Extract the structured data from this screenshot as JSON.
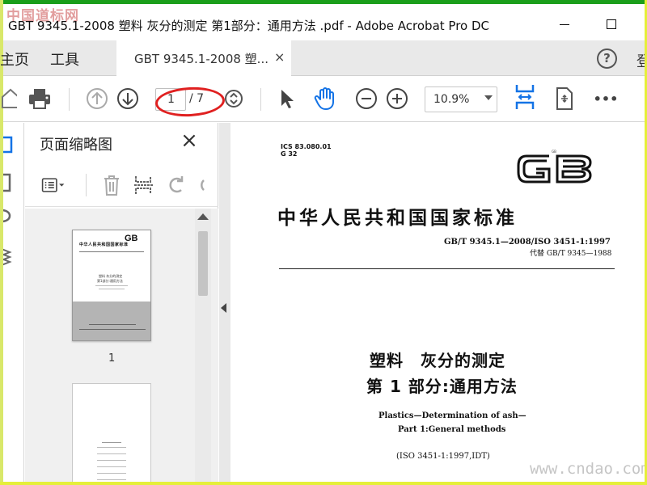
{
  "window": {
    "title": "GBT 9345.1-2008 塑料 灰分的测定 第1部分：通用方法 .pdf - Adobe Acrobat Pro DC",
    "watermark_top": "中国道标网"
  },
  "nav": {
    "home_label": "主页",
    "tools_label": "工具",
    "doc_tab_label": "GBT 9345.1-2008 塑...",
    "doc_tab_close": "×",
    "help_label": "?",
    "signin_label": "登"
  },
  "toolbar": {
    "current_page": "1",
    "total_pages": "/ 7",
    "zoom": "10.9%",
    "more_label": "•••",
    "icons": [
      "home-icon",
      "print-icon",
      "page-up-icon",
      "page-down-icon",
      "page-stepper-icon",
      "select-icon",
      "hand-icon",
      "zoom-out-icon",
      "zoom-in-icon",
      "fit-width-icon",
      "rotate-page-icon",
      "more-icon"
    ],
    "highlight_color": "#e02020",
    "accent_color": "#1473e6"
  },
  "panel": {
    "title": "页面缩略图",
    "close_label": "×",
    "thumb_labels": [
      "1"
    ],
    "thumb1": {
      "gb": "GB",
      "title": "中华人民共和国国家标准",
      "line1": "塑料 灰分的测定",
      "line2": "第1部分:通用方法"
    }
  },
  "document": {
    "ics": "ICS 83.080.01",
    "g": "G 32",
    "gb_logo": "GB",
    "main_title": "中华人民共和国国家标准",
    "code": "GB/T 9345.1—2008/ISO 3451-1:1997",
    "replace": "代替 GB/T 9345—1988",
    "cn_title1": "塑料　灰分的测定",
    "cn_title2": "第 1 部分:通用方法",
    "en_title1": "Plastics—Determination of ash—",
    "en_title2": "Part 1:General methods",
    "iso": "(ISO 3451-1:1997,IDT)"
  },
  "watermark_bottom": "www.cndao.com"
}
